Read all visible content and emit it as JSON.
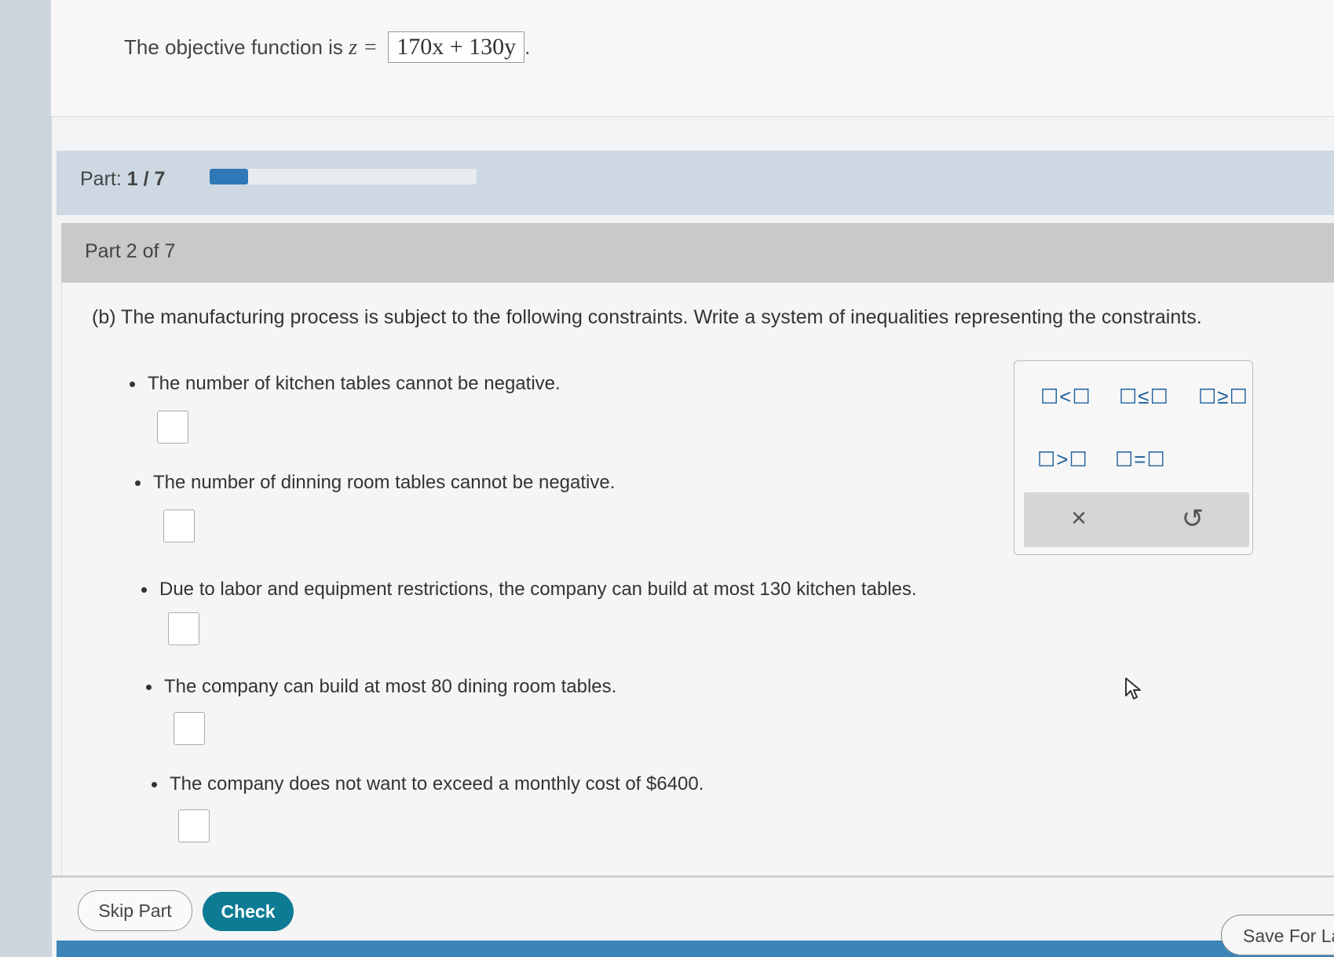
{
  "objective": {
    "prefix": "The objective function is ",
    "z": "z =",
    "answer": "170x + 130y",
    "suffix": "."
  },
  "progress": {
    "part_label": "Part:",
    "part_count": "1 / 7",
    "fraction": 0.143,
    "color": "#2f78b7"
  },
  "part_header": "Part 2 of 7",
  "instruction": "(b) The manufacturing process is subject to the following constraints. Write a system of inequalities representing the constraints.",
  "constraints": [
    {
      "text": "The number of kitchen tables cannot be negative.",
      "value": ""
    },
    {
      "text": "The number of dinning room tables cannot be negative.",
      "value": ""
    },
    {
      "text": "Due to labor and equipment restrictions, the company can build at most 130 kitchen tables.",
      "value": ""
    },
    {
      "text": "The company can build at most 80 dining room tables.",
      "value": ""
    },
    {
      "text": "The company does not want to exceed a monthly cost of $6400.",
      "value": ""
    }
  ],
  "palette": {
    "symbols": [
      "☐<☐",
      "☐≤☐",
      "☐≥☐",
      "☐>☐",
      "☐=☐"
    ],
    "clear_icon": "×",
    "undo_icon": "↺"
  },
  "buttons": {
    "skip": "Skip Part",
    "check": "Check",
    "save": "Save For Later"
  },
  "colors": {
    "check_button": "#0d7b94",
    "symbol": "#1f5f9e"
  }
}
